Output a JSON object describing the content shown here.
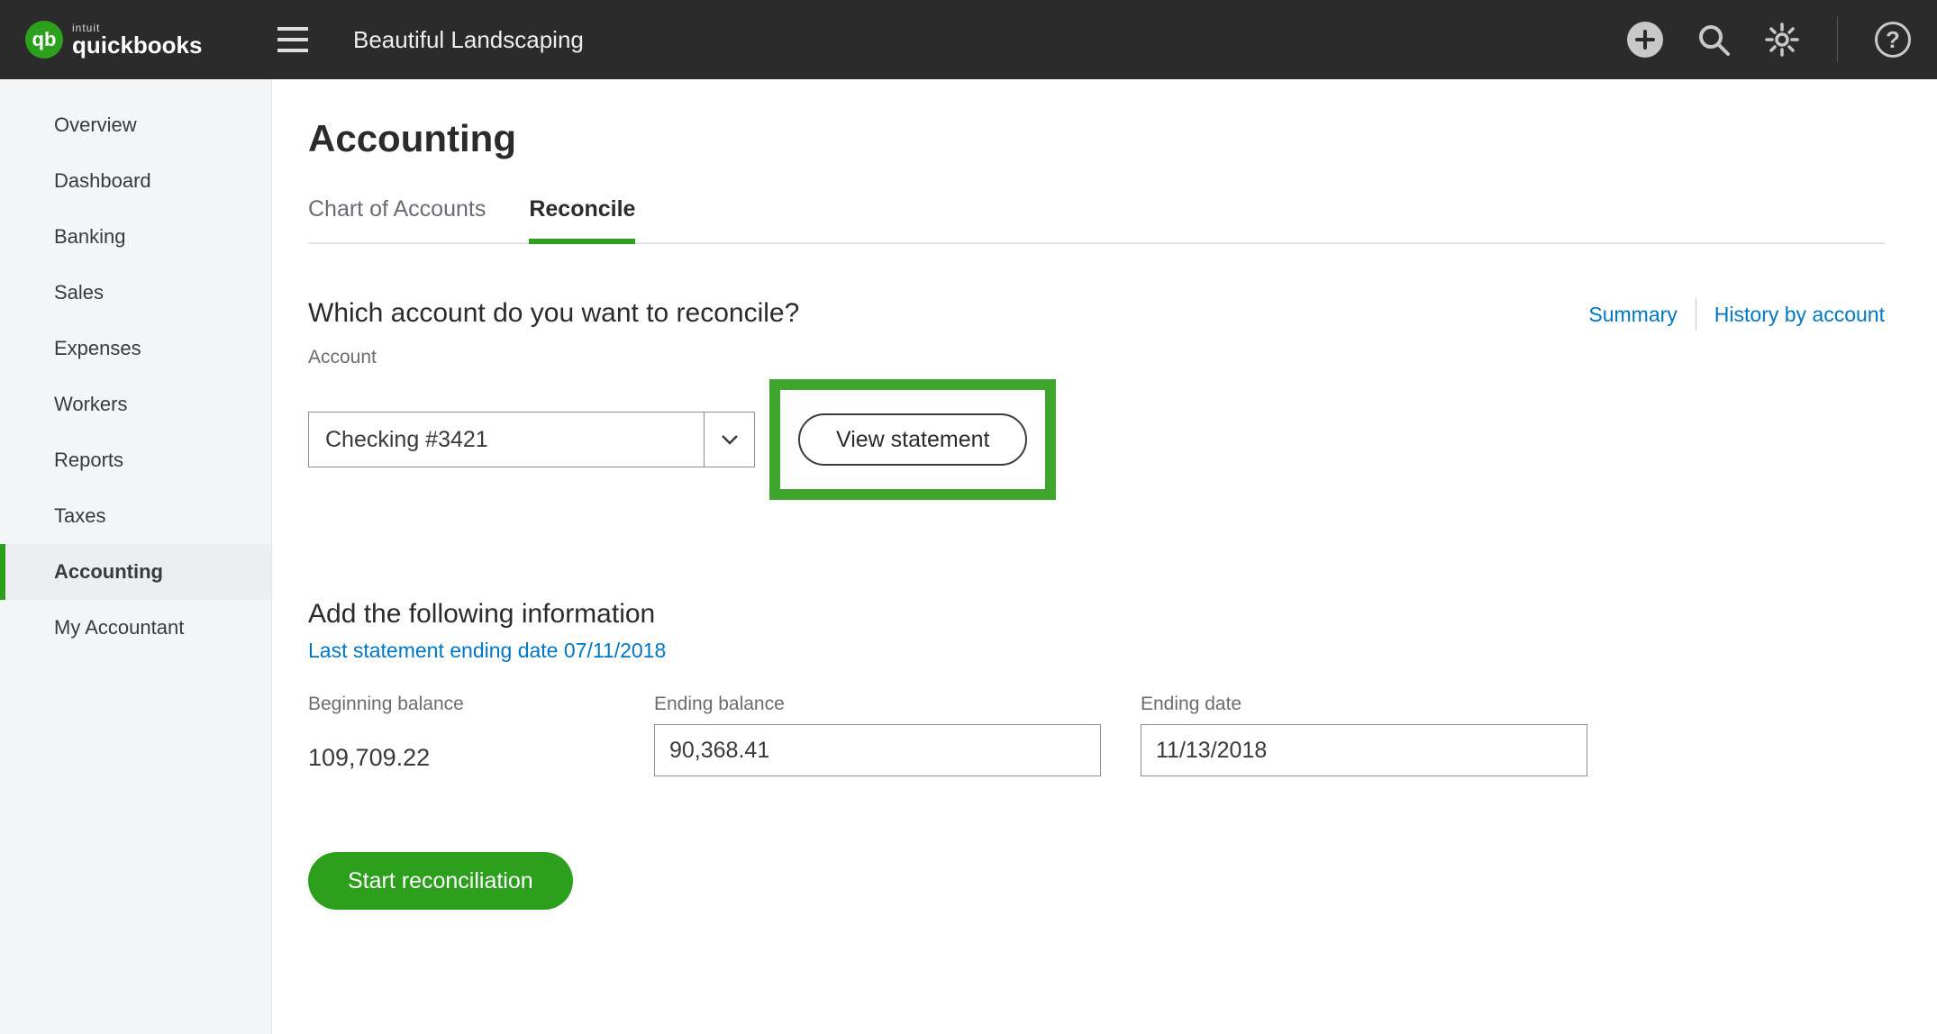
{
  "brand": {
    "intuit": "intuit",
    "name": "quickbooks",
    "glyph": "qb"
  },
  "company": "Beautiful Landscaping",
  "sidebar": {
    "items": [
      {
        "label": "Overview"
      },
      {
        "label": "Dashboard"
      },
      {
        "label": "Banking"
      },
      {
        "label": "Sales"
      },
      {
        "label": "Expenses"
      },
      {
        "label": "Workers"
      },
      {
        "label": "Reports"
      },
      {
        "label": "Taxes"
      },
      {
        "label": "Accounting"
      },
      {
        "label": "My Accountant"
      }
    ],
    "active_index": 8
  },
  "page": {
    "title": "Accounting",
    "tabs": [
      {
        "label": "Chart of Accounts"
      },
      {
        "label": "Reconcile"
      }
    ],
    "active_tab_index": 1
  },
  "reconcile": {
    "question": "Which account do you want to reconcile?",
    "links": {
      "summary": "Summary",
      "history": "History by account"
    },
    "account_label": "Account",
    "account_value": "Checking #3421",
    "view_statement": "View statement",
    "info_heading": "Add the following information",
    "last_statement": "Last statement ending date 07/11/2018",
    "beginning_label": "Beginning balance",
    "beginning_value": "109,709.22",
    "ending_balance_label": "Ending balance",
    "ending_balance_value": "90,368.41",
    "ending_date_label": "Ending date",
    "ending_date_value": "11/13/2018",
    "start_button": "Start reconciliation"
  }
}
